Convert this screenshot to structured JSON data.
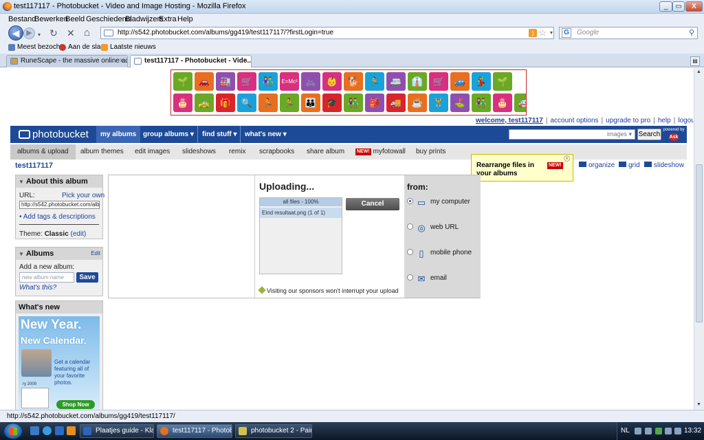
{
  "window": {
    "title": "test117117 - Photobucket - Video and Image Hosting - Mozilla Firefox",
    "minimize": "_",
    "restore": "▭",
    "close": "X"
  },
  "menu": [
    "Bestand",
    "Bewerken",
    "Beeld",
    "Geschiedenis",
    "Bladwijzers",
    "Extra",
    "Help"
  ],
  "nav": {
    "url": "http://s542.photobucket.com/albums/gg419/test117117/?firstLogin=true",
    "search_placeholder": "Google",
    "back_icon": "◀",
    "forward_icon": "▶",
    "reload_icon": "↻",
    "stop_icon": "✕",
    "home_icon": "⌂"
  },
  "bookmarks": [
    "Meest bezocht",
    "Aan de slag",
    "Laatste nieuws"
  ],
  "tabs": [
    {
      "label": "RuneScape - the massive online adv...",
      "active": false
    },
    {
      "label": "test117117 - Photobucket - Vide...",
      "active": true
    }
  ],
  "banner": {
    "row1": [
      "🌱",
      "🚗",
      "🏭",
      "🛒",
      "👫",
      "E=Mc²",
      "🚲",
      "👶",
      "🐕",
      "🏃",
      "🚐",
      "👔",
      "🛒",
      "🚙",
      "💃",
      "🌱"
    ],
    "row2": [
      "🎂",
      "🚕",
      "🎁",
      "🔍",
      "🏃",
      "🏃",
      "👪",
      "🎓",
      "👫",
      "🎒",
      "🚚",
      "☕",
      "🏋",
      "⛳",
      "👫",
      "🎂",
      "🚑"
    ],
    "colors1": [
      "#6aa826",
      "#e76f1f",
      "#8e4fb0",
      "#d8307e",
      "#1aa2d8",
      "#d8307e",
      "#8e4fb0",
      "#d8307e",
      "#e76f1f",
      "#1aa2d8",
      "#8e4fb0",
      "#6aa826",
      "#d8307e",
      "#e76f1f",
      "#1aa2d8",
      "#6aa826"
    ],
    "colors2": [
      "#d8307e",
      "#6aa826",
      "#d8242c",
      "#1aa2d8",
      "#e76f1f",
      "#6aa826",
      "#e76f1f",
      "#d8242c",
      "#6aa826",
      "#8e4fb0",
      "#d8242c",
      "#e76f1f",
      "#1aa2d8",
      "#8e4fb0",
      "#6aa826",
      "#d8307e",
      "#6aa826"
    ]
  },
  "userlinks": {
    "welcome": "welcome, test117117",
    "account": "account options",
    "upgrade": "upgrade to pro",
    "help": "help",
    "logout": "logout",
    "separator": "|"
  },
  "header": {
    "logo": "photobucket",
    "nav": [
      "my albums",
      "group albums ▾",
      "find stuff ▾",
      "what's new ▾"
    ],
    "search_scope": "images ▾",
    "search_button": "Search",
    "powered_by": "powered by",
    "ask": "Ask"
  },
  "subnav": [
    "albums & upload",
    "album themes",
    "edit images",
    "slideshows",
    "remix",
    "scrapbooks",
    "share album",
    "myfotowall",
    "buy prints"
  ],
  "subnav_badge": "NEW!",
  "album_title": "test117117",
  "tooltip": {
    "text_line1": "Rearrange files in",
    "text_line2": "your albums",
    "badge": "NEW!",
    "close": "x"
  },
  "views": [
    "organize",
    "grid",
    "slideshow"
  ],
  "about": {
    "title": "About this album",
    "url_label": "URL:",
    "pick_own": "Pick your own",
    "url_value": "http://s542.photobucket.com/albums/gg419/test117117/",
    "tags_link": "Add tags & descriptions",
    "theme_label": "Theme:",
    "theme_value": "Classic",
    "theme_edit": "(edit)"
  },
  "albums_panel": {
    "title": "Albums",
    "edit": "Edit",
    "add_label": "Add a new album:",
    "placeholder": "new album name",
    "save": "Save",
    "whats_this": "What's this?"
  },
  "whatsnew": {
    "title": "What's new",
    "promo_line1": "New Year.",
    "promo_line2": "New Calendar.",
    "promo_desc": "Get a calendar featuring all of your favorite photos.",
    "promo_year": "ry 2009",
    "shop": "Shop Now"
  },
  "uploader": {
    "heading": "Uploading...",
    "all_files": "all files - 100%",
    "file": "Eind resultaat.png (1 of 1)",
    "cancel": "Cancel",
    "sponsor": "Visiting our sponsors won't interrupt your upload",
    "from_label": "from:",
    "sources": [
      "my computer",
      "web URL",
      "mobile phone",
      "email"
    ]
  },
  "status": "http://s542.photobucket.com/albums/gg419/test117117/",
  "taskbar": {
    "items": [
      "Plaatjes guide - Klad...",
      "test117117 - Photob...",
      "photobucket 2 - Paint"
    ],
    "lang": "NL",
    "clock": "13:32"
  }
}
